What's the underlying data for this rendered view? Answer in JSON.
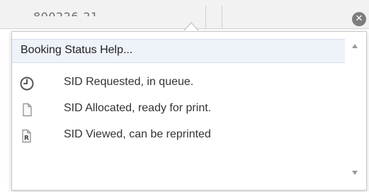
{
  "background_cell": {
    "text": "800226-21"
  },
  "popup": {
    "title": "Booking Status Help...",
    "items": [
      {
        "icon": "clock-icon",
        "label": "SID Requested, in queue."
      },
      {
        "icon": "blank-document-icon",
        "label": "SID Allocated, ready for print."
      },
      {
        "icon": "document-r-icon",
        "label": "SID Viewed, can be reprinted"
      }
    ]
  },
  "colors": {
    "header_bg": "#eef2f9",
    "icon_stroke": "#555555",
    "close_button": "#7d7d7d"
  }
}
